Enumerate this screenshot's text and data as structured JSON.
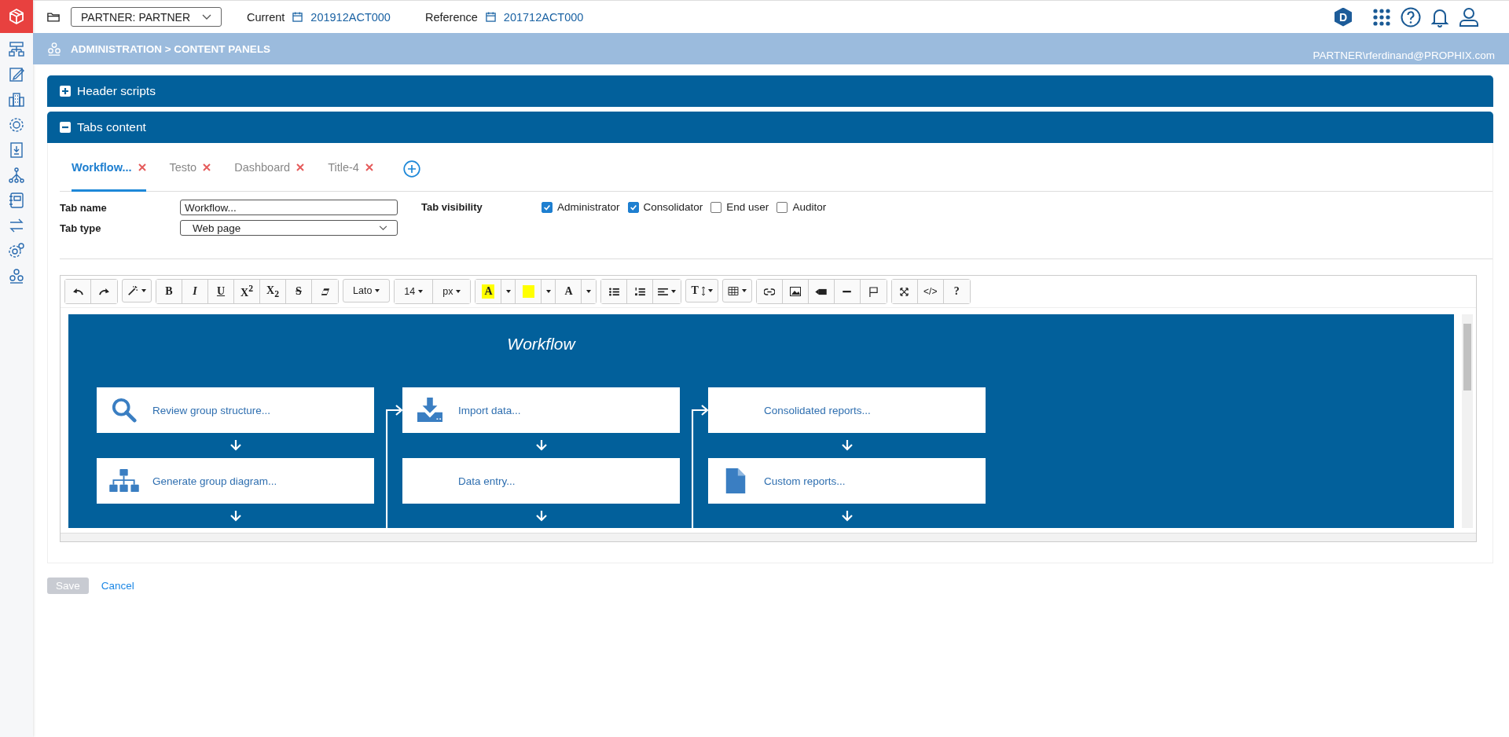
{
  "top_bar": {
    "entity": "PARTNER: PARTNER",
    "current_label": "Current",
    "current_value": "201912ACT000",
    "reference_label": "Reference",
    "reference_value": "201712ACT000",
    "badge": "D"
  },
  "breadcrumb": {
    "path": "ADMINISTRATION > CONTENT PANELS",
    "user": "PARTNER\\rferdinand@PROPHIX.com"
  },
  "panels": [
    {
      "title": "Header scripts",
      "expanded": false
    },
    {
      "title": "Tabs content",
      "expanded": true
    }
  ],
  "tabs": [
    {
      "label": "Workflow...",
      "selected": true
    },
    {
      "label": "Testo",
      "selected": false
    },
    {
      "label": "Dashboard",
      "selected": false
    },
    {
      "label": "Title-4",
      "selected": false
    }
  ],
  "form": {
    "tab_name_label": "Tab name",
    "tab_name_value": "Workflow...",
    "tab_type_label": "Tab type",
    "tab_type_value": "Web page",
    "visibility_label": "Tab visibility",
    "visibility": [
      {
        "label": "Administrator",
        "checked": true
      },
      {
        "label": "Consolidator",
        "checked": true
      },
      {
        "label": "End user",
        "checked": false
      },
      {
        "label": "Auditor",
        "checked": false
      }
    ]
  },
  "toolbar": [
    [
      {
        "kind": "undo"
      },
      {
        "kind": "redo"
      }
    ],
    [
      {
        "kind": "wand",
        "caret": true
      }
    ],
    [
      {
        "kind": "bold",
        "label": "B"
      },
      {
        "kind": "italic",
        "label": "I"
      },
      {
        "kind": "underline",
        "label": "U"
      },
      {
        "kind": "rich",
        "label": "X$^{2}$"
      },
      {
        "kind": "rich",
        "label": "X$_{2}$"
      },
      {
        "kind": "strike",
        "label": "S"
      },
      {
        "kind": "eraser"
      }
    ],
    [
      {
        "kind": "dropdown",
        "label": "Lato",
        "caret": true
      }
    ],
    [
      {
        "kind": "dropdown",
        "label": "14",
        "caret": true
      },
      {
        "kind": "dropdown",
        "label": "px",
        "caret": true
      }
    ],
    [
      {
        "kind": "highlight",
        "label": "A"
      },
      {
        "kind": "split",
        "caret": true
      },
      {
        "kind": "swatch"
      },
      {
        "kind": "split",
        "caret": true
      },
      {
        "kind": "bold",
        "label": "A"
      },
      {
        "kind": "split",
        "caret": true
      }
    ],
    [
      {
        "kind": "bullets"
      },
      {
        "kind": "numbers"
      },
      {
        "kind": "align",
        "caret": true
      }
    ],
    [
      {
        "kind": "lineheight",
        "label": "T",
        "caret": true
      }
    ],
    [
      {
        "kind": "table",
        "caret": true
      }
    ],
    [
      {
        "kind": "link"
      },
      {
        "kind": "image"
      },
      {
        "kind": "video"
      },
      {
        "kind": "rule"
      },
      {
        "kind": "flag"
      }
    ],
    [
      {
        "kind": "fullscreen"
      },
      {
        "kind": "text",
        "label": "</>"
      },
      {
        "kind": "bold",
        "label": "?"
      }
    ]
  ],
  "editor": {
    "title": "Workflow",
    "columns": [
      [
        {
          "kind": "search",
          "label": "Review group structure..."
        },
        {
          "kind": "hierarchy",
          "label": "Generate group diagram..."
        }
      ],
      [
        {
          "kind": "download",
          "label": "Import data..."
        },
        {
          "kind": "plain",
          "label": "Data entry..."
        }
      ],
      [
        {
          "kind": "plain",
          "label": "Consolidated reports..."
        },
        {
          "kind": "document",
          "label": "Custom reports..."
        }
      ]
    ]
  },
  "actions": {
    "save": {
      "label": "Save",
      "disabled": true
    },
    "cancel": "Cancel"
  }
}
